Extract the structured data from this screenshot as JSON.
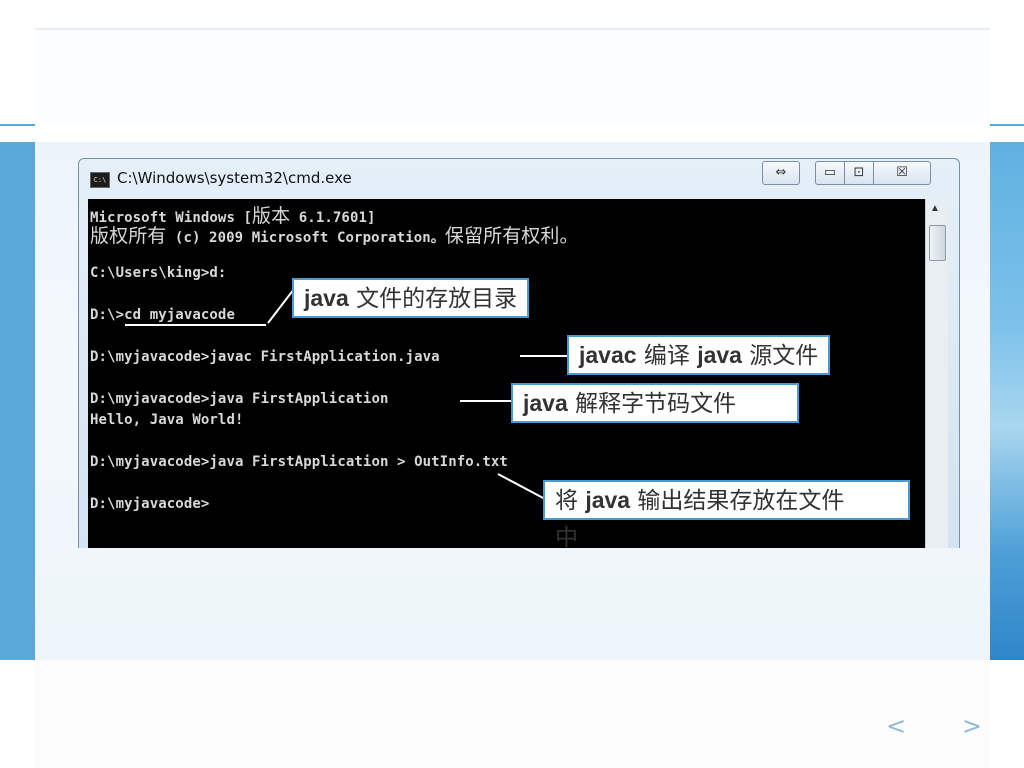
{
  "window": {
    "title": "C:\\Windows\\system32\\cmd.exe",
    "icon": "cmd-icon",
    "icon_text": "C:\\",
    "controls": {
      "resize": "⇔",
      "minimize": "▭",
      "maximize": "⊡",
      "close": "☒"
    }
  },
  "console": {
    "lines": [
      {
        "pre": "Microsoft Windows [",
        "cn": "版本",
        "post": " 6.1.7601]"
      },
      {
        "pre": "",
        "cn": "版权所有",
        "post": " (c) 2009 Microsoft Corporation。",
        "cn2": "保留所有权利。"
      },
      {
        "text": "C:\\Users\\king>d:"
      },
      {
        "text": "D:\\>cd myjavacode"
      },
      {
        "text": "D:\\myjavacode>javac FirstApplication.java"
      },
      {
        "text": "D:\\myjavacode>java FirstApplication"
      },
      {
        "text": "Hello, Java World!"
      },
      {
        "text": "D:\\myjavacode>java FirstApplication > OutInfo.txt"
      },
      {
        "text": "D:\\myjavacode>"
      }
    ]
  },
  "callouts": {
    "dir": {
      "bold": "java",
      "text": " 文件的存放目录"
    },
    "compile": {
      "bold": "javac",
      "text": " 编译 ",
      "bold2": "java",
      "text2": " 源文件"
    },
    "interpret": {
      "bold": "java",
      "text": " 解释字节码文件"
    },
    "output": {
      "pre": "将 ",
      "bold": "java",
      "text": " 输出结果存放在文件",
      "wrap": "中"
    }
  },
  "nav": {
    "prev": "<",
    "next": ">"
  },
  "colors": {
    "accent": "#5aa8d8",
    "callout_border": "#4a9ad4",
    "console_bg": "#000000"
  }
}
